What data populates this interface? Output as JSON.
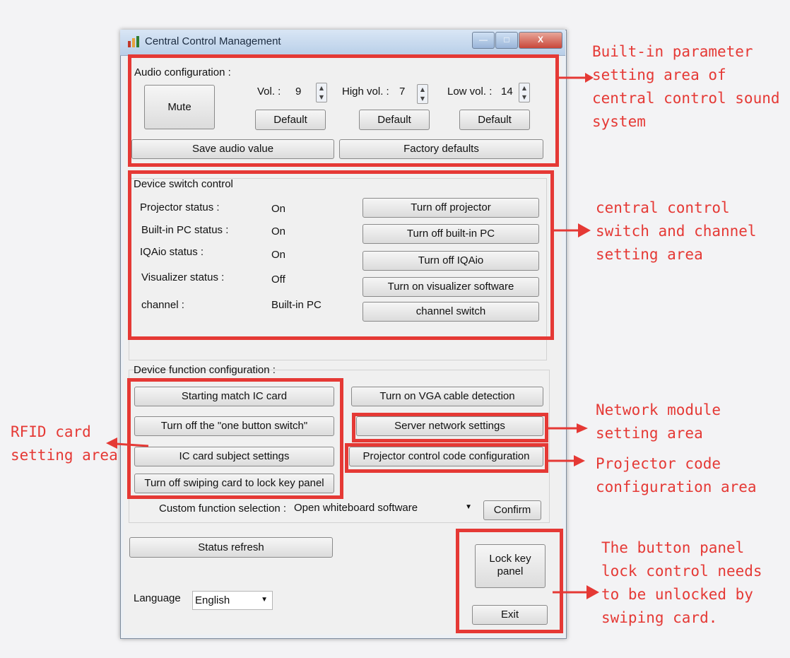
{
  "window": {
    "title": "Central Control Management",
    "controls": {
      "minimize": "—",
      "maximize": "□",
      "close": "X"
    }
  },
  "audio": {
    "section_label": "Audio configuration :",
    "mute_label": "Mute",
    "vol_label": "Vol. :",
    "vol_value": "9",
    "high_vol_label": "High vol. :",
    "high_vol_value": "7",
    "low_vol_label": "Low vol. :",
    "low_vol_value": "14",
    "default_label": "Default",
    "save_label": "Save audio value",
    "factory_label": "Factory defaults"
  },
  "devices": {
    "section_label": "Device switch control",
    "rows": [
      {
        "label": "Projector status :",
        "value": "On",
        "button": "Turn off projector"
      },
      {
        "label": "Built-in PC status :",
        "value": "On",
        "button": "Turn off built-in PC"
      },
      {
        "label": "IQAio status :",
        "value": "On",
        "button": "Turn off IQAio"
      },
      {
        "label": "Visualizer status :",
        "value": "Off",
        "button": "Turn on visualizer software"
      },
      {
        "label": "channel :",
        "value": "Built-in PC",
        "button": "channel switch"
      }
    ]
  },
  "functions": {
    "section_label": "Device function configuration :",
    "start_ic": "Starting match IC card",
    "vga_detect": "Turn on VGA cable detection",
    "one_button": "Turn off the \"one button switch\"",
    "server_net": "Server network settings",
    "ic_subject": "IC card subject settings",
    "proj_code": "Projector control code configuration",
    "swipe_lock": "Turn off swiping card to lock key panel",
    "custom_label": "Custom function selection :",
    "custom_value": "Open whiteboard software",
    "confirm": "Confirm"
  },
  "bottom": {
    "status_refresh": "Status refresh",
    "lock_panel": [
      "Lock key",
      "panel"
    ],
    "exit": "Exit",
    "language_label": "Language",
    "language_value": "English"
  },
  "annotations": {
    "audio": [
      "Built-in parameter",
      "setting area of",
      "central control sound",
      "system"
    ],
    "switch": [
      "central control",
      "switch and channel",
      "setting area"
    ],
    "rfid": [
      "RFID card",
      "setting area"
    ],
    "network": [
      "Network module",
      "setting area"
    ],
    "projector": [
      "Projector code",
      "configuration area"
    ],
    "lock": [
      "The button panel",
      "lock control needs",
      "to be unlocked by",
      "swiping card."
    ]
  },
  "colors": {
    "annotation_red": "#e53935"
  }
}
